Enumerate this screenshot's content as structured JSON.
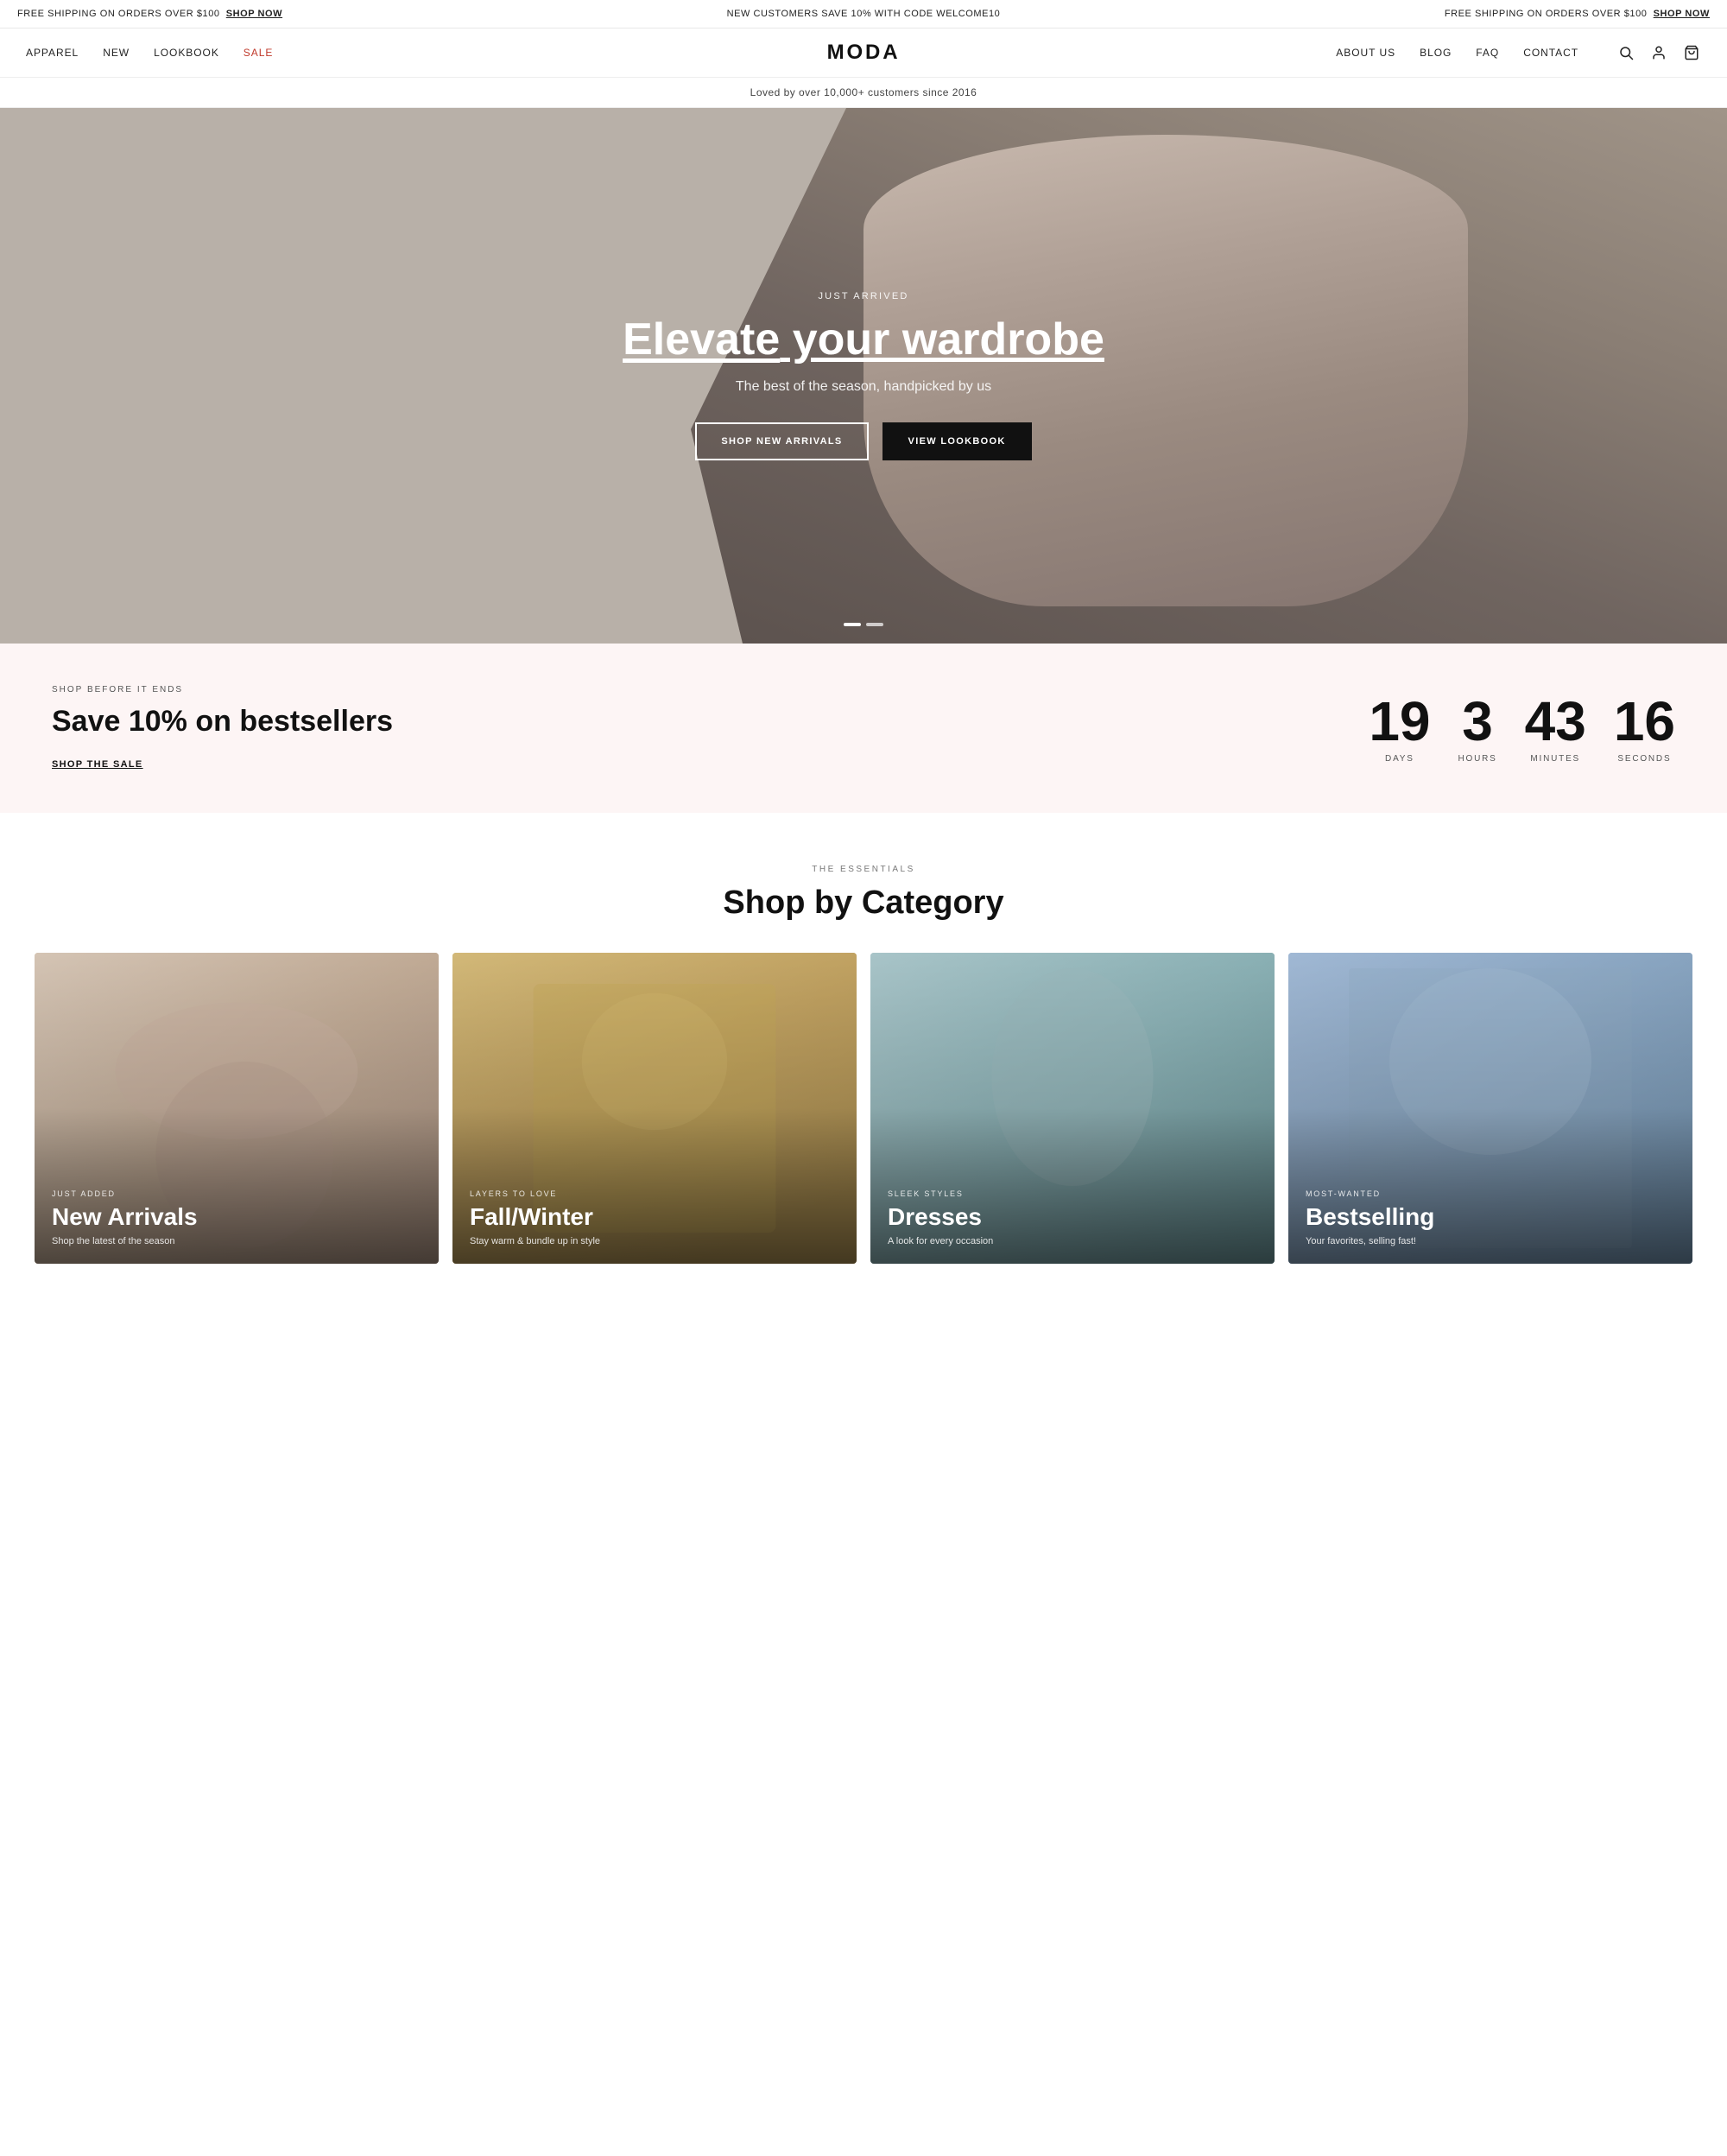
{
  "announcement": {
    "left": "FREE SHIPPING ON ORDERS OVER $100",
    "left_link": "SHOP NOW",
    "center": "NEW CUSTOMERS SAVE 10% WITH CODE WELCOME10",
    "right": "FREE SHIPPING ON ORDERS OVER $100",
    "right_link": "SHOP NOW"
  },
  "nav": {
    "left_links": [
      {
        "label": "APPAREL",
        "id": "apparel"
      },
      {
        "label": "NEW",
        "id": "new"
      },
      {
        "label": "LOOKBOOK",
        "id": "lookbook"
      },
      {
        "label": "SALE",
        "id": "sale",
        "special": true
      }
    ],
    "logo": "MODA",
    "right_links": [
      {
        "label": "ABOUT US",
        "id": "about"
      },
      {
        "label": "BLOG",
        "id": "blog"
      },
      {
        "label": "FAQ",
        "id": "faq"
      },
      {
        "label": "CONTACT",
        "id": "contact"
      }
    ]
  },
  "sub_banner": "Loved by over 10,000+ customers since 2016",
  "hero": {
    "eyebrow": "JUST ARRIVED",
    "title_part1": "Elevate",
    "title_part2": " your wardrobe",
    "subtitle": "The best of the season, handpicked by us",
    "btn_left": "SHOP NEW ARRIVALS",
    "btn_right": "VIEW LOOKBOOK"
  },
  "sale_section": {
    "eyebrow": "SHOP BEFORE IT ENDS",
    "title": "Save 10% on bestsellers",
    "link": "SHOP THE SALE",
    "countdown": {
      "days": "19",
      "hours": "3",
      "minutes": "43",
      "seconds": "16",
      "days_label": "DAYS",
      "hours_label": "HOURS",
      "minutes_label": "MINUTES",
      "seconds_label": "SECONDS"
    }
  },
  "category_section": {
    "eyebrow": "THE ESSENTIALS",
    "title": "Shop by Category",
    "categories": [
      {
        "eyebrow": "JUST ADDED",
        "name": "New Arrivals",
        "desc": "Shop the latest of the season",
        "id": "new-arrivals"
      },
      {
        "eyebrow": "LAYERS TO LOVE",
        "name": "Fall/Winter",
        "desc": "Stay warm & bundle up in style",
        "id": "fall-winter"
      },
      {
        "eyebrow": "SLEEK STYLES",
        "name": "Dresses",
        "desc": "A look for every occasion",
        "id": "dresses"
      },
      {
        "eyebrow": "MOST-WANTED",
        "name": "Bestselling",
        "desc": "Your favorites, selling fast!",
        "id": "bestselling"
      }
    ]
  },
  "colors": {
    "sale_bg": "#fdf5f5",
    "hero_overlay": "rgba(0,0,0,0.18)"
  }
}
